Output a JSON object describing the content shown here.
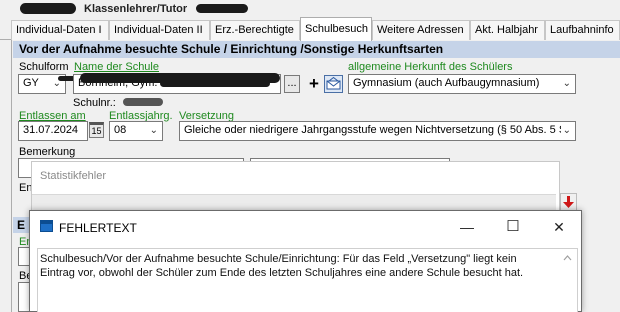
{
  "top": {
    "title_fragment": "Klassenlehrer/Tutor"
  },
  "tabs": [
    {
      "label": "Individual-Daten I"
    },
    {
      "label": "Individual-Daten II"
    },
    {
      "label": "Erz.-Berechtigte"
    },
    {
      "label": "Schulbesuch"
    },
    {
      "label": "Weitere Adressen"
    },
    {
      "label": "Akt. Halbjahr"
    },
    {
      "label": "Laufbahninfo"
    }
  ],
  "section": {
    "title": "Vor der Aufnahme besuchte Schule / Einrichtung /Sonstige Herkunftsarten"
  },
  "form": {
    "schulform_label": "Schulform",
    "schulform_value": "GY",
    "name_label": "Name der Schule",
    "name_value": "Bornheim, Gym.",
    "dots_label": "...",
    "plus_label": "+",
    "herkunft_label": "allgemeine Herkunft des Schülers",
    "herkunft_value": "Gymnasium (auch Aufbaugymnasium)",
    "schulnr_label": "Schulnr.:",
    "entlassen_label": "Entlassen am",
    "entlassen_value": "31.07.2024",
    "calendar_label": "15",
    "entlassjahrg_label": "Entlassjahrg.",
    "entlassjahrg_value": "08",
    "versetzung_label": "Versetzung",
    "versetzung_value": "Gleiche oder niedrigere Jahrgangsstufe wegen Nichtversetzung (§ 50 Abs. 5 S",
    "bemerkung_label": "Bemerkung",
    "en_label": "En",
    "e_head": "E",
    "en2_label": "En",
    "be_label": "Be"
  },
  "statistik": {
    "title": "Statistikfehler"
  },
  "fehlertext": {
    "title": "FEHLERTEXT",
    "minimize": "—",
    "maximize": "☐",
    "close": "✕",
    "message": "Schulbesuch/Vor der Aufnahme besuchte Schule/Einrichtung: Für das Feld „Versetzung\" liegt kein Eintrag vor, obwohl der Schüler zum Ende des letzten Schuljahres eine andere Schule besucht hat."
  },
  "colors": {
    "section_head": "#c5d3e8",
    "green_label": "#1f8a1f",
    "arrow_red": "#d01818",
    "title_icon": "#1e6fc6"
  }
}
